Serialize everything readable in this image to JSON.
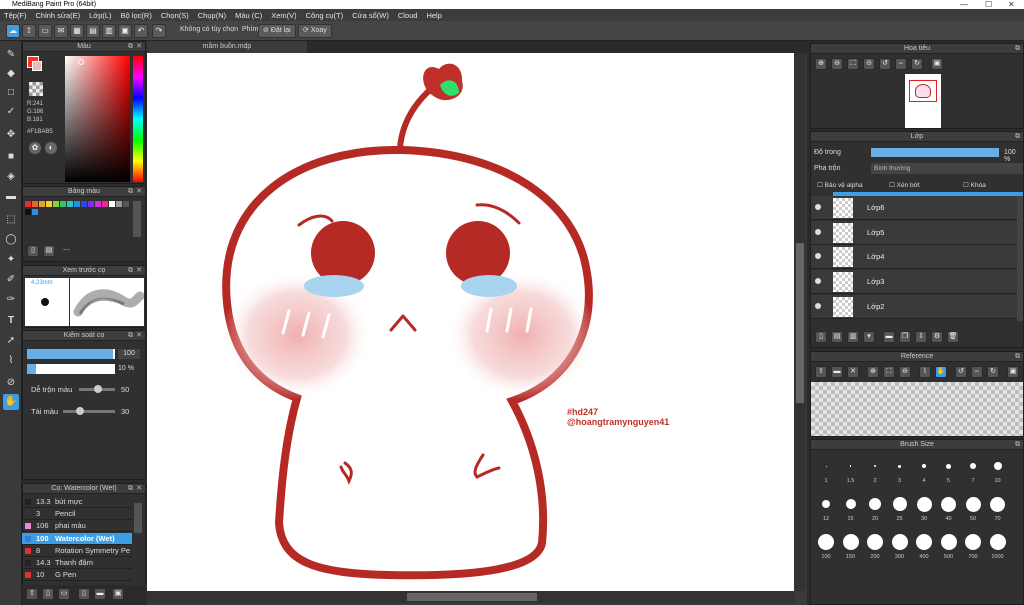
{
  "app": {
    "title": "MediBang Paint Pro (64bit)"
  },
  "menu": [
    "Tệp(F)",
    "Chỉnh sửa(E)",
    "Lớp(L)",
    "Bộ lọc(R)",
    "Chọn(S)",
    "Chụp(N)",
    "Màu (C)",
    "Xem(V)",
    "Công cụ(T)",
    "Cửa sổ(W)",
    "Cloud",
    "Help"
  ],
  "toolbar": {
    "selection_label": "Không có tùy chọn",
    "keys_label": "Phím",
    "reset_label": "Đặt lại",
    "rotate_label": "Xoay"
  },
  "document": {
    "tab": "mầm buồn.mdp"
  },
  "color_panel": {
    "title": "Màu",
    "r": "R:241",
    "g": "G:186",
    "b": "B:181",
    "hex": "#F1BAB5"
  },
  "palette_panel": {
    "title": "Bảng màu",
    "more": "---"
  },
  "brush_preview_panel": {
    "title": "Xem trước cọ",
    "size": "4.23mm"
  },
  "brush_control_panel": {
    "title": "Kiểm soát cọ",
    "size_value": "100",
    "opacity_value": "10 %",
    "blend_label": "Dễ trộn màu",
    "blend_value": "50",
    "resource_label": "Tài màu",
    "resource_value": "30"
  },
  "brush_list_panel": {
    "title": "Cọ: Watercolor (Wet)",
    "items": [
      {
        "size": "13.3",
        "name": "bút mực",
        "color": "#222222"
      },
      {
        "size": "3",
        "name": "Pencil",
        "color": "#333333"
      },
      {
        "size": "106",
        "name": "phai màu",
        "color": "#e78ad8"
      },
      {
        "size": "100",
        "name": "Watercolor (Wet)",
        "color": "#3a7ad0",
        "selected": true
      },
      {
        "size": "8",
        "name": "Rotation Symmetry Pe",
        "color": "#e03030"
      },
      {
        "size": "14.3",
        "name": "Thanh đậm",
        "color": "#222222"
      },
      {
        "size": "10",
        "name": "G Pen",
        "color": "#e03030"
      }
    ]
  },
  "navigator_panel": {
    "title": "Hoa tiêu"
  },
  "layer_panel": {
    "title": "Lớp",
    "opacity_label": "Độ trong",
    "opacity_value": "100 %",
    "blend_label": "Pha trộn",
    "blend_value": "Bình thường",
    "protect_alpha": "Bảo vệ alpha",
    "clipping": "Xén bớt",
    "lock": "Khóa",
    "layers": [
      "Lớp6",
      "Lớp5",
      "Lớp4",
      "Lớp3",
      "Lớp2"
    ]
  },
  "reference_panel": {
    "title": "Reference"
  },
  "brush_size_panel": {
    "title": "Brush Size",
    "sizes": [
      "1",
      "1.5",
      "2",
      "3",
      "4",
      "5",
      "7",
      "10",
      "12",
      "15",
      "20",
      "25",
      "30",
      "40",
      "50",
      "70",
      "100",
      "150",
      "200",
      "300",
      "400",
      "500",
      "700",
      "1000"
    ]
  },
  "artwork": {
    "hashtag": "#hd247",
    "handle": "@hoangtramynguyen41"
  },
  "colors": {
    "accent": "#3d9ee8",
    "stroke": "#b52a25",
    "blush": "#eea7a7",
    "tear": "#a8d4ef",
    "leaf": "#2ee06a",
    "fg": "#f7332c"
  }
}
